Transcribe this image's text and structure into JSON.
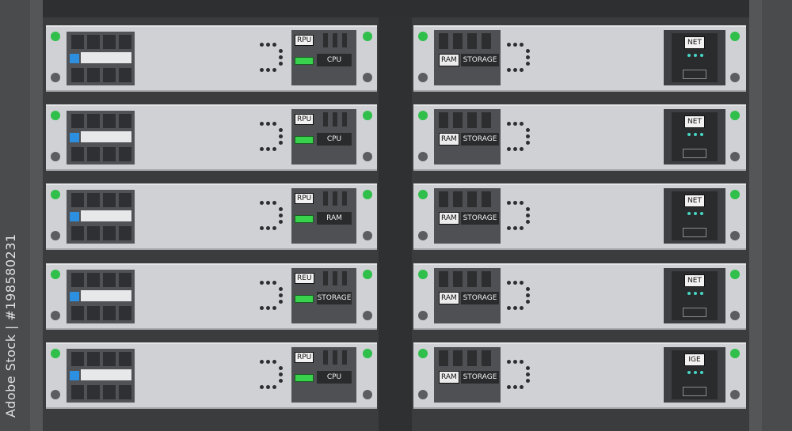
{
  "watermark": "Adobe Stock",
  "stock_id_text": "Adobe Stock | #198580231",
  "colors": {
    "led_green": "#2fbf4a",
    "bay_button_blue": "#2c8fe0",
    "net_indicator": "#47d6c6",
    "unit_face": "#cfd1d4"
  },
  "left_units": [
    {
      "tag": "RPU",
      "status": "CPU"
    },
    {
      "tag": "RPU",
      "status": "CPU"
    },
    {
      "tag": "RPU",
      "status": "RAM"
    },
    {
      "tag": "REU",
      "status": "STORAGE"
    },
    {
      "tag": "RPU",
      "status": "CPU"
    }
  ],
  "right_units": [
    {
      "ram": "RAM",
      "storage": "STORAGE",
      "net": "NET"
    },
    {
      "ram": "RAM",
      "storage": "STORAGE",
      "net": "NET"
    },
    {
      "ram": "RAM",
      "storage": "STORAGE",
      "net": "NET"
    },
    {
      "ram": "RAM",
      "storage": "STORAGE",
      "net": "NET"
    },
    {
      "ram": "RAM",
      "storage": "STORAGE",
      "net": "IGE"
    }
  ]
}
